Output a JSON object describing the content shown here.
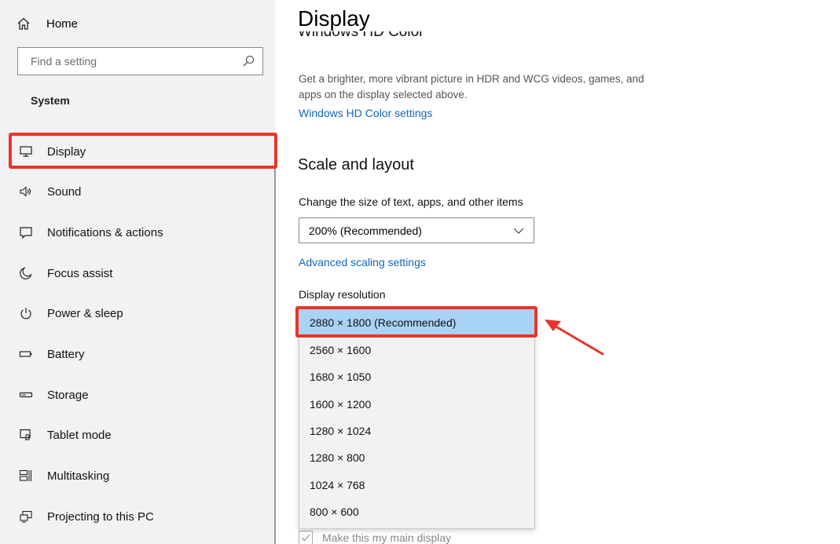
{
  "sidebar": {
    "home_label": "Home",
    "search_placeholder": "Find a setting",
    "section_label": "System",
    "items": [
      {
        "label": "Display",
        "icon": "monitor-icon"
      },
      {
        "label": "Sound",
        "icon": "speaker-icon"
      },
      {
        "label": "Notifications & actions",
        "icon": "notification-icon"
      },
      {
        "label": "Focus assist",
        "icon": "moon-icon"
      },
      {
        "label": "Power & sleep",
        "icon": "power-icon"
      },
      {
        "label": "Battery",
        "icon": "battery-icon"
      },
      {
        "label": "Storage",
        "icon": "storage-icon"
      },
      {
        "label": "Tablet mode",
        "icon": "tablet-mode-icon"
      },
      {
        "label": "Multitasking",
        "icon": "multitasking-icon"
      },
      {
        "label": "Projecting to this PC",
        "icon": "projecting-icon"
      }
    ],
    "selected": "Display"
  },
  "main": {
    "title": "Display",
    "hd_color_heading": "Windows HD Color",
    "hd_color_description": "Get a brighter, more vibrant picture in HDR and WCG videos, games, and apps on the display selected above.",
    "hd_color_link": "Windows HD Color settings",
    "scale_heading": "Scale and layout",
    "scale_label": "Change the size of text, apps, and other items",
    "scale_value": "200% (Recommended)",
    "advanced_link": "Advanced scaling settings",
    "resolution_label": "Display resolution",
    "resolution_options": [
      "2880 × 1800 (Recommended)",
      "2560 × 1600",
      "1680 × 1050",
      "1600 × 1200",
      "1280 × 1024",
      "1280 × 800",
      "1024 × 768",
      "800 × 600"
    ],
    "resolution_selected": "2880 × 1800 (Recommended)",
    "main_display_checkbox": "Make this my main display"
  },
  "colors": {
    "annotation_red": "#e8352a",
    "link_blue": "#1166bb",
    "selected_option_bg": "#a9d3f5",
    "sidebar_bg": "#f2f2f2"
  }
}
